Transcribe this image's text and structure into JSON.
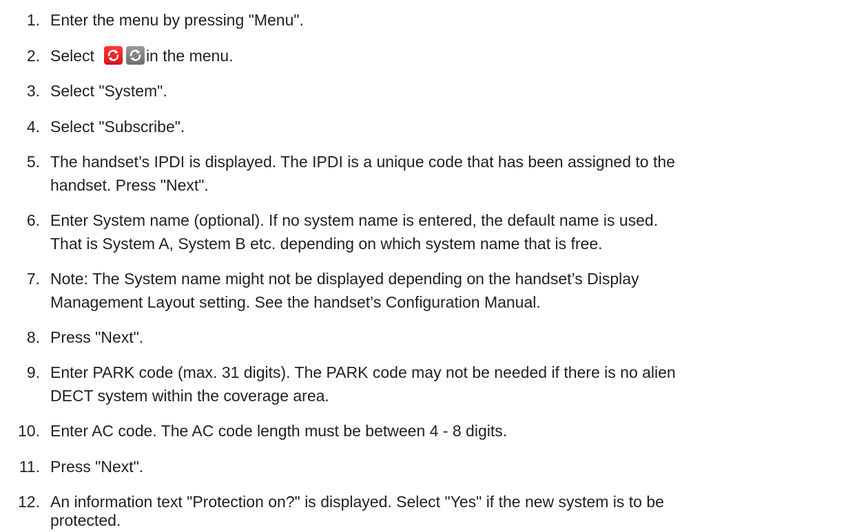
{
  "steps": [
    {
      "num": "1.",
      "lines": [
        "Enter the menu by pressing \"Menu\"."
      ]
    },
    {
      "num": "2.",
      "before": "Select",
      "after": "in the menu.",
      "icons": [
        "red-sync-icon",
        "grey-sync-icon"
      ]
    },
    {
      "num": "3.",
      "lines": [
        "Select \"System\"."
      ]
    },
    {
      "num": "4.",
      "lines": [
        "Select \"Subscribe\"."
      ]
    },
    {
      "num": "5.",
      "lines": [
        "The handset’s IPDI is displayed. The IPDI is a unique code that has been assigned to the",
        "handset. Press \"Next\"."
      ]
    },
    {
      "num": "6.",
      "lines": [
        "Enter System name (optional). If no system name is entered, the default name is used.",
        "That is System A, System B etc. depending on which system name that is free."
      ]
    },
    {
      "num": "7.",
      "lines": [
        "Note: The System name might not be displayed depending on the handset’s Display",
        "Management Layout setting. See the handset’s Configuration Manual."
      ]
    },
    {
      "num": "8.",
      "lines": [
        "Press \"Next\"."
      ]
    },
    {
      "num": "9.",
      "lines": [
        "Enter PARK code (max. 31 digits). The PARK code may not be needed if there is no alien",
        "DECT system within the coverage area."
      ]
    },
    {
      "num": "10.",
      "lines": [
        "Enter AC code. The AC code length must be between 4 - 8 digits."
      ]
    },
    {
      "num": "11.",
      "lines": [
        "Press \"Next\"."
      ]
    },
    {
      "num": "12.",
      "lines": [
        "An information text \"Protection on?\" is displayed. Select \"Yes\" if the new system is to be",
        "protected."
      ]
    }
  ],
  "colors": {
    "text": "#231f20",
    "red_icon": "#e8161c",
    "grey_icon": "#808080"
  }
}
